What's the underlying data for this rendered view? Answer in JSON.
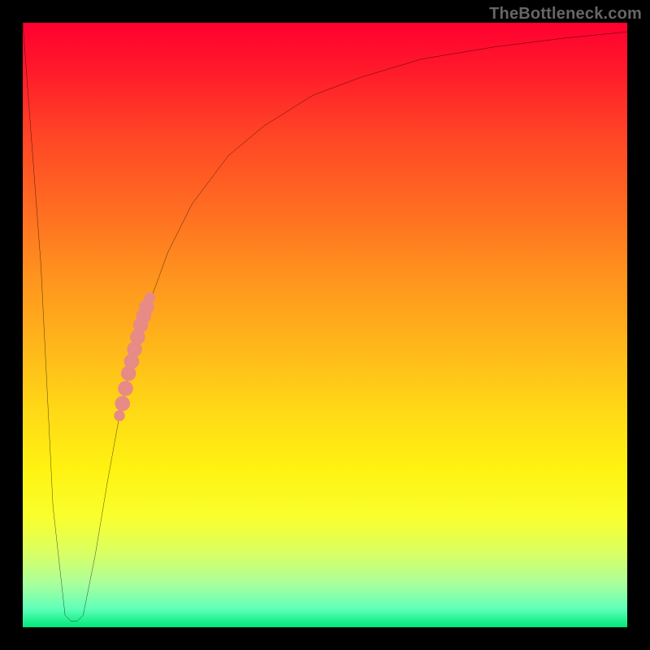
{
  "watermark": "TheBottleneck.com",
  "chart_data": {
    "type": "line",
    "title": "",
    "xlabel": "",
    "ylabel": "",
    "xlim": [
      0,
      100
    ],
    "ylim": [
      0,
      100
    ],
    "grid": false,
    "legend": false,
    "series": [
      {
        "name": "bottleneck-curve",
        "color": "#000000",
        "x": [
          0,
          3,
          5,
          7,
          8,
          9,
          10,
          12,
          14,
          16,
          18,
          20,
          24,
          28,
          34,
          40,
          48,
          56,
          66,
          78,
          90,
          100
        ],
        "y": [
          100,
          60,
          20,
          2,
          1,
          1,
          2,
          12,
          24,
          35,
          44,
          51,
          62,
          70,
          78,
          83,
          88,
          91,
          94,
          96,
          97.5,
          98.5
        ]
      }
    ],
    "highlight_points": {
      "name": "highlighted-region",
      "color": "#e88a85",
      "points": [
        {
          "x": 16.0,
          "y": 35
        },
        {
          "x": 16.5,
          "y": 37
        },
        {
          "x": 17.0,
          "y": 39.5
        },
        {
          "x": 17.5,
          "y": 42
        },
        {
          "x": 18.0,
          "y": 44
        },
        {
          "x": 18.5,
          "y": 46
        },
        {
          "x": 19.0,
          "y": 48
        },
        {
          "x": 19.5,
          "y": 50
        },
        {
          "x": 20.0,
          "y": 51.5
        },
        {
          "x": 20.5,
          "y": 53
        },
        {
          "x": 21.0,
          "y": 54.5
        }
      ]
    }
  }
}
